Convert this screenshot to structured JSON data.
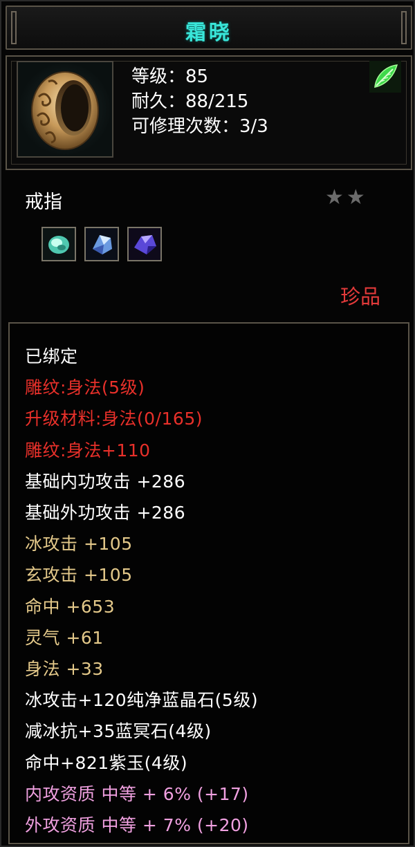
{
  "item": {
    "name": "霜晓",
    "level_line": "等级：85",
    "durability_line": "耐久：88/215",
    "repair_line": "可修理次数：3/3",
    "type": "戒指",
    "stars": "★★",
    "rarity": "珍品",
    "icon": "ring-icon",
    "badge_icon": "leaf-icon"
  },
  "gems": [
    {
      "name": "green-gem-icon",
      "color": "#7fe0c8"
    },
    {
      "name": "blue-crystal-icon",
      "color": "#8fb8f0"
    },
    {
      "name": "purple-jade-icon",
      "color": "#8a6ae8"
    }
  ],
  "attributes": [
    {
      "text": "已绑定",
      "color": "white"
    },
    {
      "text": "雕纹:身法(5级)",
      "color": "red"
    },
    {
      "text": "升级材料:身法(0/165)",
      "color": "red"
    },
    {
      "text": "雕纹:身法+110",
      "color": "red"
    },
    {
      "text": "基础内功攻击  +286",
      "color": "white"
    },
    {
      "text": "基础外功攻击  +286",
      "color": "white"
    },
    {
      "text": "冰攻击  +105",
      "color": "gold"
    },
    {
      "text": "玄攻击  +105",
      "color": "gold"
    },
    {
      "text": "命中  +653",
      "color": "gold"
    },
    {
      "text": "灵气  +61",
      "color": "gold"
    },
    {
      "text": "身法  +33",
      "color": "gold"
    },
    {
      "text": "冰攻击+120纯净蓝晶石(5级)",
      "color": "white"
    },
    {
      "text": "减冰抗+35蓝冥石(4级)",
      "color": "white"
    },
    {
      "text": "命中+821紫玉(4级)",
      "color": "white"
    },
    {
      "text": "内攻资质  中等  +  6% (+17)",
      "color": "pink"
    },
    {
      "text": "外攻资质  中等  +  7% (+20)",
      "color": "pink"
    }
  ],
  "colors": {
    "title": "#39e6d9",
    "red": "#e8302a",
    "gold": "#e4c98a",
    "pink": "#f0a0e0",
    "rarity": "#e23a3a"
  }
}
